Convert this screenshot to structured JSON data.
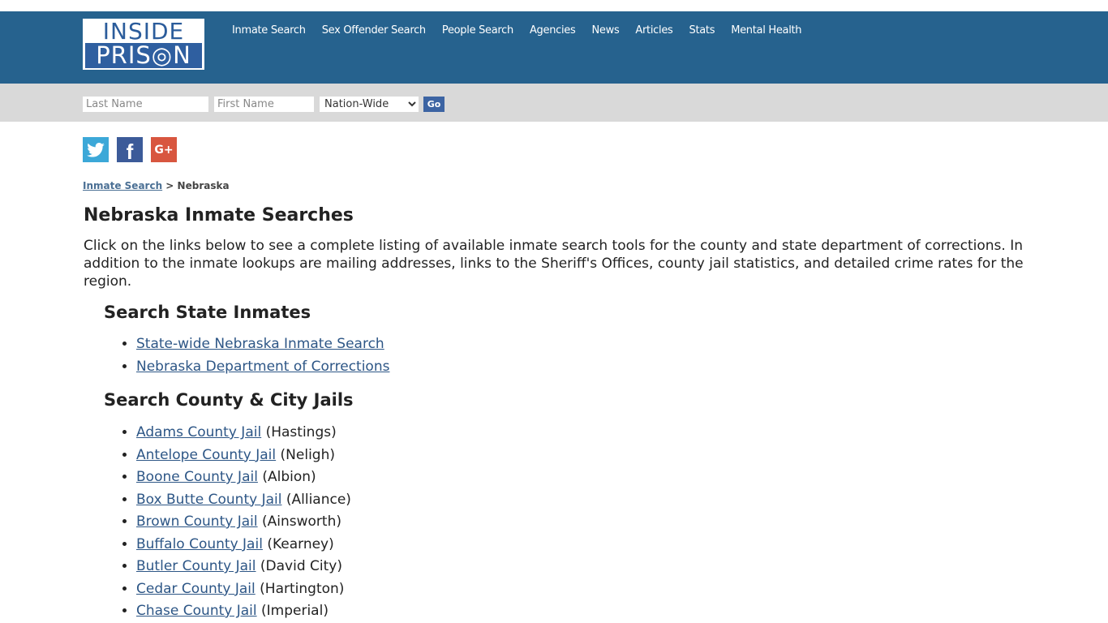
{
  "header": {
    "logo": {
      "line1": "INSIDE",
      "line2": "PRIS◎N"
    },
    "nav": [
      "Inmate Search",
      "Sex Offender Search",
      "People Search",
      "Agencies",
      "News",
      "Articles",
      "Stats",
      "Mental Health"
    ]
  },
  "search": {
    "last_name_placeholder": "Last Name",
    "first_name_placeholder": "First Name",
    "scope_selected": "Nation-Wide",
    "go_label": "Go"
  },
  "social": {
    "twitter": "twitter-icon",
    "facebook": "f",
    "google_plus": "G+"
  },
  "breadcrumb": {
    "link": "Inmate Search",
    "separator": " > ",
    "current": "Nebraska"
  },
  "page_title": "Nebraska Inmate Searches",
  "intro": "Click on the links below to see a complete listing of available inmate search tools for the county and state department of corrections. In addition to the inmate lookups are mailing addresses, links to the Sheriff's Offices, county jail statistics, and detailed crime rates for the region.",
  "state_section": {
    "heading": "Search State Inmates",
    "links": [
      "State-wide Nebraska Inmate Search",
      "Nebraska Department of Corrections"
    ]
  },
  "county_section": {
    "heading": "Search County & City Jails",
    "items": [
      {
        "link": "Adams County Jail",
        "city": " (Hastings)"
      },
      {
        "link": "Antelope County Jail",
        "city": " (Neligh)"
      },
      {
        "link": "Boone County Jail",
        "city": " (Albion)"
      },
      {
        "link": "Box Butte County Jail",
        "city": " (Alliance)"
      },
      {
        "link": "Brown County Jail",
        "city": " (Ainsworth)"
      },
      {
        "link": "Buffalo County Jail",
        "city": " (Kearney)"
      },
      {
        "link": "Butler County Jail",
        "city": " (David City)"
      },
      {
        "link": "Cedar County Jail",
        "city": " (Hartington)"
      },
      {
        "link": "Chase County Jail",
        "city": " (Imperial)"
      }
    ]
  }
}
